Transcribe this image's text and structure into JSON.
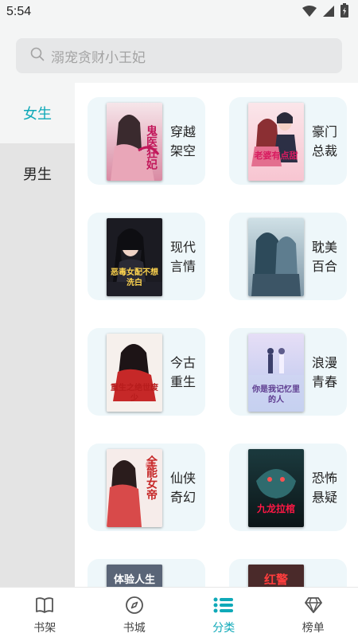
{
  "status_bar": {
    "time": "5:54",
    "icons": [
      "wifi-icon",
      "signal-icon",
      "battery-icon"
    ]
  },
  "search": {
    "placeholder": "溺宠贪财小王妃",
    "icon": "search-icon"
  },
  "sidebar": {
    "tabs": [
      {
        "label": "女生",
        "active": true
      },
      {
        "label": "男生",
        "active": false
      }
    ]
  },
  "categories": [
    {
      "label": "穿越架空",
      "cover_text": "鬼医狂妃"
    },
    {
      "label": "豪门总裁",
      "cover_text": "老婆有点甜"
    },
    {
      "label": "现代言情",
      "cover_text": "恶毒女配不想洗白"
    },
    {
      "label": "耽美百合",
      "cover_text": ""
    },
    {
      "label": "今古重生",
      "cover_text": "重生之绝世废少"
    },
    {
      "label": "浪漫青春",
      "cover_text": "你是我记忆里的人"
    },
    {
      "label": "仙侠奇幻",
      "cover_text": "全能女帝"
    },
    {
      "label": "恐怖悬疑",
      "cover_text": "九龙拉棺"
    },
    {
      "label": "",
      "cover_text": "体验人生"
    },
    {
      "label": "",
      "cover_text": "红警"
    }
  ],
  "bottom_nav": [
    {
      "label": "书架",
      "icon": "book-icon",
      "active": false
    },
    {
      "label": "书城",
      "icon": "compass-icon",
      "active": false
    },
    {
      "label": "分类",
      "icon": "category-list-icon",
      "active": true
    },
    {
      "label": "榜单",
      "icon": "diamond-icon",
      "active": false
    }
  ],
  "colors": {
    "accent": "#0fa9b8",
    "card_bg": "#eef7fa",
    "search_bg": "#e6e7e8",
    "sidebar_inactive_bg": "#e4e4e4"
  }
}
